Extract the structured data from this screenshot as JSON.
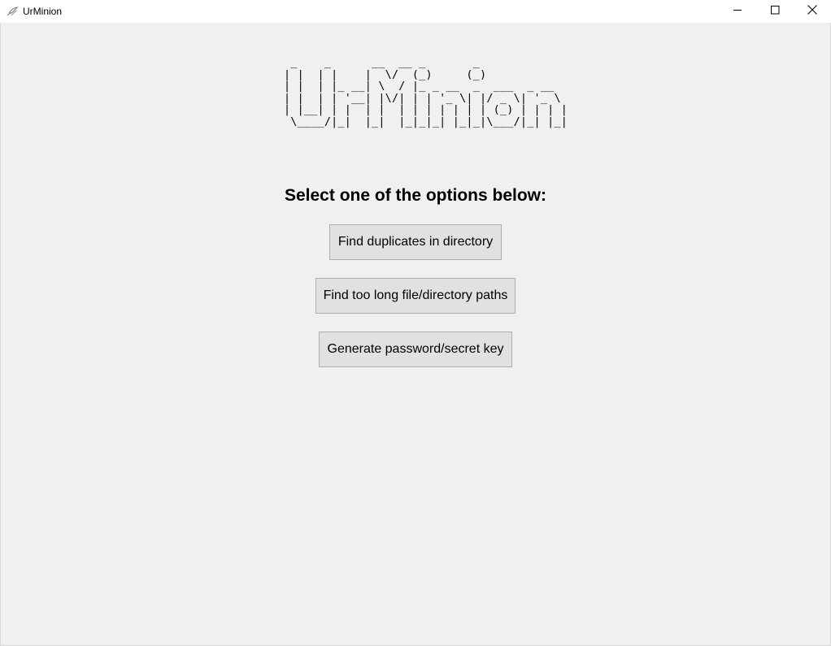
{
  "window": {
    "title": "UrMinion",
    "app_icon": "feather-icon",
    "controls": {
      "minimize": "minimize-icon",
      "maximize": "maximize-icon",
      "close": "close-icon"
    }
  },
  "main": {
    "logo_ascii": " _    _      __  __ _       _\n| |  | |    |  \\/  (_)     (_)\n| |  | |_ __| \\  / |_ _ __  _  ___  _ __\n| |  | | '__| |\\/| | | '_ \\| |/ _ \\| '_ \\\n| |__| | |  | |  | | | | | | | (_) | | | |\n \\____/|_|  |_|  |_|_|_| |_|_|\\___/|_| |_|",
    "heading": "Select one of the options below:",
    "buttons": [
      {
        "label": "Find duplicates in directory"
      },
      {
        "label": "Find too long file/directory paths"
      },
      {
        "label": "Generate password/secret key"
      }
    ]
  },
  "colors": {
    "background": "#f0f0f0",
    "titlebar": "#ffffff",
    "button_face": "#e1e1e1",
    "button_border": "#adadad"
  }
}
